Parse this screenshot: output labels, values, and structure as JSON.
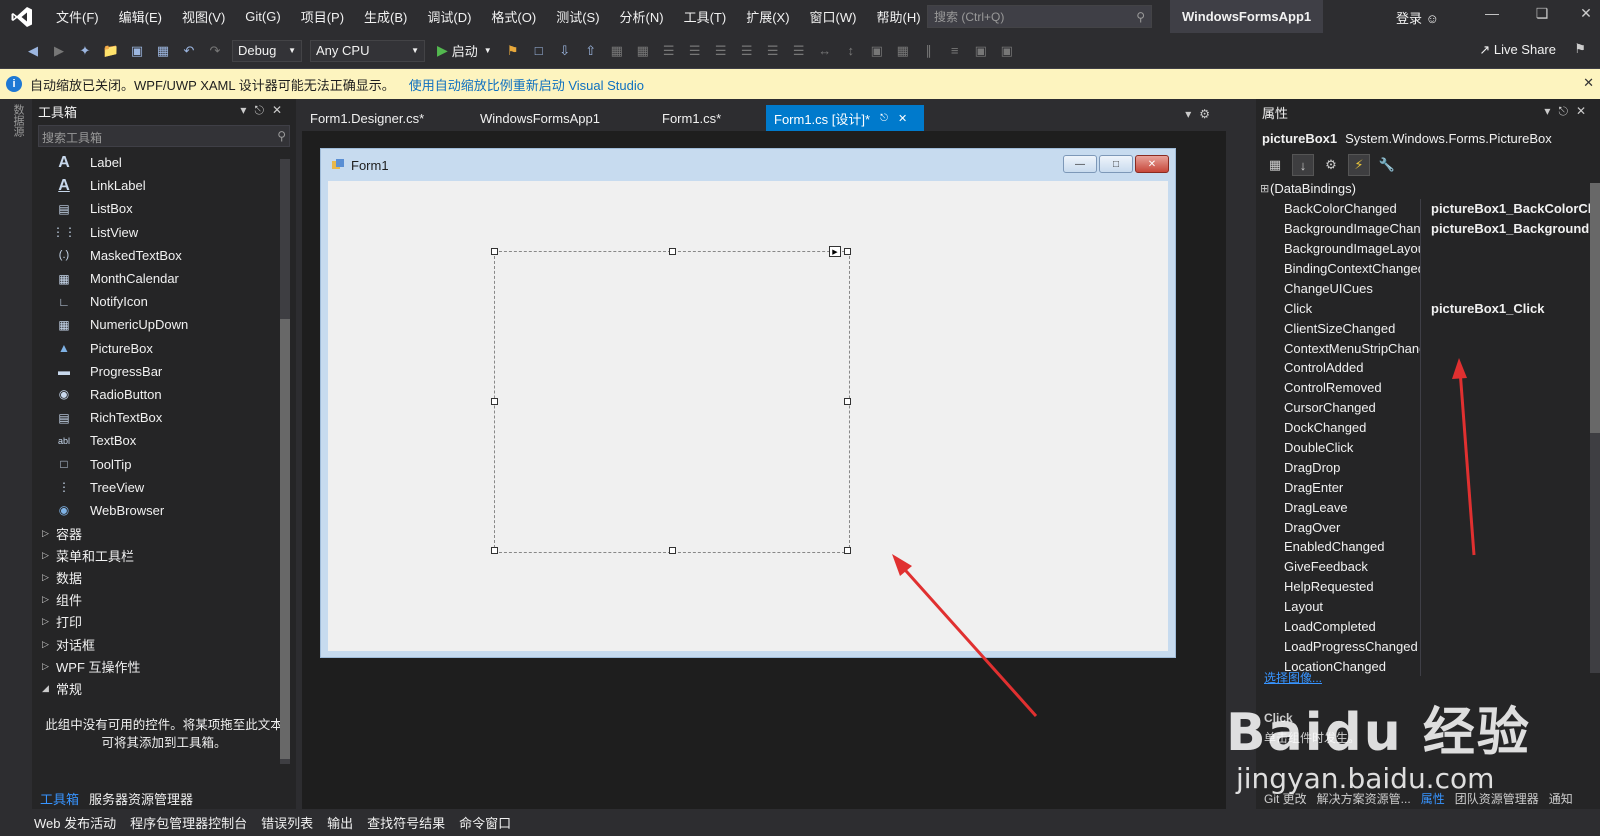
{
  "menubar": {
    "items": [
      "文件(F)",
      "编辑(E)",
      "视图(V)",
      "Git(G)",
      "项目(P)",
      "生成(B)",
      "调试(D)",
      "格式(O)",
      "测试(S)",
      "分析(N)",
      "工具(T)",
      "扩展(X)",
      "窗口(W)",
      "帮助(H)"
    ],
    "search_placeholder": "搜索 (Ctrl+Q)",
    "project_name": "WindowsFormsApp1",
    "login": "登录"
  },
  "toolbar": {
    "config": "Debug",
    "platform": "Any CPU",
    "start_label": "启动",
    "live_share": "Live Share"
  },
  "infobar": {
    "message": "自动缩放已关闭。WPF/UWP XAML 设计器可能无法正确显示。",
    "link": "使用自动缩放比例重新启动 Visual Studio"
  },
  "leftstrip": {
    "vertical_tab": "数据源"
  },
  "toolbox": {
    "title": "工具箱",
    "search_placeholder": "搜索工具箱",
    "items": [
      "Label",
      "LinkLabel",
      "ListBox",
      "ListView",
      "MaskedTextBox",
      "MonthCalendar",
      "NotifyIcon",
      "NumericUpDown",
      "PictureBox",
      "ProgressBar",
      "RadioButton",
      "RichTextBox",
      "TextBox",
      "ToolTip",
      "TreeView",
      "WebBrowser"
    ],
    "groups": [
      "容器",
      "菜单和工具栏",
      "数据",
      "组件",
      "打印",
      "对话框",
      "WPF 互操作性"
    ],
    "expanded_group": "常规",
    "empty_note": "此组中没有可用的控件。将某项拖至此文本可将其添加到工具箱。",
    "bottom_tabs": [
      "工具箱",
      "服务器资源管理器"
    ]
  },
  "doc_tabs": [
    "Form1.Designer.cs*",
    "WindowsFormsApp1",
    "Form1.cs*",
    "Form1.cs [设计]*"
  ],
  "form": {
    "title": "Form1"
  },
  "properties": {
    "title": "属性",
    "object_name": "pictureBox1",
    "object_type": "System.Windows.Forms.PictureBox",
    "rows": [
      {
        "name": "(DataBindings)",
        "value": ""
      },
      {
        "name": "BackColorChanged",
        "value": "pictureBox1_BackColorCl"
      },
      {
        "name": "BackgroundImageChang",
        "value": "pictureBox1_Background"
      },
      {
        "name": "BackgroundImageLayou",
        "value": ""
      },
      {
        "name": "BindingContextChanged",
        "value": ""
      },
      {
        "name": "ChangeUICues",
        "value": ""
      },
      {
        "name": "Click",
        "value": "pictureBox1_Click"
      },
      {
        "name": "ClientSizeChanged",
        "value": ""
      },
      {
        "name": "ContextMenuStripChang",
        "value": ""
      },
      {
        "name": "ControlAdded",
        "value": ""
      },
      {
        "name": "ControlRemoved",
        "value": ""
      },
      {
        "name": "CursorChanged",
        "value": ""
      },
      {
        "name": "DockChanged",
        "value": ""
      },
      {
        "name": "DoubleClick",
        "value": ""
      },
      {
        "name": "DragDrop",
        "value": ""
      },
      {
        "name": "DragEnter",
        "value": ""
      },
      {
        "name": "DragLeave",
        "value": ""
      },
      {
        "name": "DragOver",
        "value": ""
      },
      {
        "name": "EnabledChanged",
        "value": ""
      },
      {
        "name": "GiveFeedback",
        "value": ""
      },
      {
        "name": "HelpRequested",
        "value": ""
      },
      {
        "name": "Layout",
        "value": ""
      },
      {
        "name": "LoadCompleted",
        "value": ""
      },
      {
        "name": "LoadProgressChanged",
        "value": ""
      },
      {
        "name": "LocationChanged",
        "value": ""
      }
    ],
    "choose_image_link": "选择图像...",
    "desc_title": "Click",
    "desc_text": "单击组件时发生。",
    "bottom_tabs": [
      "Git 更改",
      "解决方案资源管...",
      "属性",
      "团队资源管理器",
      "通知"
    ]
  },
  "output_tabs": [
    "Web 发布活动",
    "程序包管理器控制台",
    "错误列表",
    "输出",
    "查找符号结果",
    "命令窗口"
  ],
  "watermark": {
    "brand": "Baidu 经验",
    "url": "jingyan.baidu.com"
  }
}
